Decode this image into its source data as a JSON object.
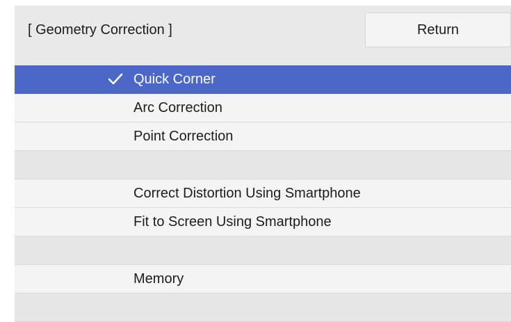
{
  "header": {
    "title": "[ Geometry Correction ]",
    "return_label": "Return"
  },
  "menu": {
    "items": [
      {
        "label": "Quick Corner",
        "selected": true,
        "checked": true
      },
      {
        "label": "Arc Correction",
        "selected": false,
        "checked": false
      },
      {
        "label": "Point Correction",
        "selected": false,
        "checked": false
      },
      {
        "label": "",
        "selected": false,
        "checked": false
      },
      {
        "label": "Correct Distortion Using Smartphone",
        "selected": false,
        "checked": false
      },
      {
        "label": "Fit to Screen Using Smartphone",
        "selected": false,
        "checked": false
      },
      {
        "label": "",
        "selected": false,
        "checked": false
      },
      {
        "label": "Memory",
        "selected": false,
        "checked": false
      },
      {
        "label": "",
        "selected": false,
        "checked": false
      }
    ]
  },
  "colors": {
    "selection": "#4b68c9",
    "panel": "#e9e9e9",
    "row": "#f4f4f4"
  }
}
